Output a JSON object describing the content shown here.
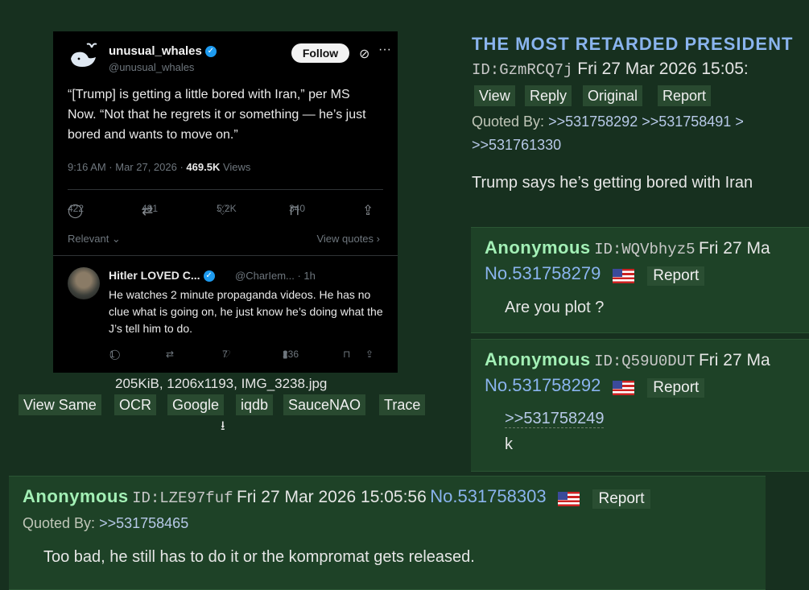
{
  "thumbnail": {
    "tweet": {
      "name": "unusual_whales",
      "handle": "@unusual_whales",
      "follow_label": "Follow",
      "text": "“[Trump] is getting a little bored with Iran,” per MS Now. “Not that he regrets it or something — he’s just bored and wants to move on.”",
      "time": "9:16 AM · Mar 27, 2026 · ",
      "views_count": "469.5K",
      "views_label": " Views",
      "replies": "422",
      "reposts": "481",
      "likes": "5.2K",
      "bookmarks": "340",
      "relevant_label": "Relevant",
      "view_quotes_label": "View quotes"
    },
    "reply_tweet": {
      "name": "Hitler LOVED C...",
      "handle": "@CharIem... · 1h",
      "text": "He watches 2 minute propaganda videos. He has no clue what is going on, he just know he’s doing what the J’s tell him to do.",
      "replies": "1",
      "likes": "7",
      "views": "236"
    }
  },
  "file": {
    "info": "205KiB, 1206x1193, IMG_3238.jpg",
    "buttons": [
      "View Same",
      "OCR",
      "Google",
      "iqdb",
      "SauceNAO",
      "Trace"
    ]
  },
  "op": {
    "subject": "THE MOST RETARDED PRESIDENT",
    "id": "ID:GzmRCQ7j",
    "date": "Fri 27 Mar 2026 15:05:",
    "buttons": [
      "View",
      "Reply",
      "Original",
      "Report"
    ],
    "quoted_by_label": "Quoted By:",
    "quoted_by": ">>531758292 >>531758491 >",
    "quoted_by_2": ">>531761330",
    "text": "Trump says he’s getting bored with Iran"
  },
  "replies": [
    {
      "name": "Anonymous",
      "id": "ID:WQVbhyz5",
      "date": "Fri 27 Ma",
      "no": "No.531758279",
      "report": "Report",
      "text": "Are you plot ?"
    },
    {
      "name": "Anonymous",
      "id": "ID:Q59U0DUT",
      "date": "Fri 27 Ma",
      "no": "No.531758292",
      "report": "Report",
      "quote_link": ">>531758249",
      "text": "k"
    },
    {
      "name": "Anonymous",
      "id": "ID:LZE97fuf",
      "date": "Fri 27 Mar 2026 15:05:56",
      "no": "No.531758303",
      "report": "Report",
      "quoted_by_label": "Quoted By:",
      "quoted_by": ">>531758465",
      "text": "Too bad, he still has to do it or the kompromat gets released."
    }
  ]
}
